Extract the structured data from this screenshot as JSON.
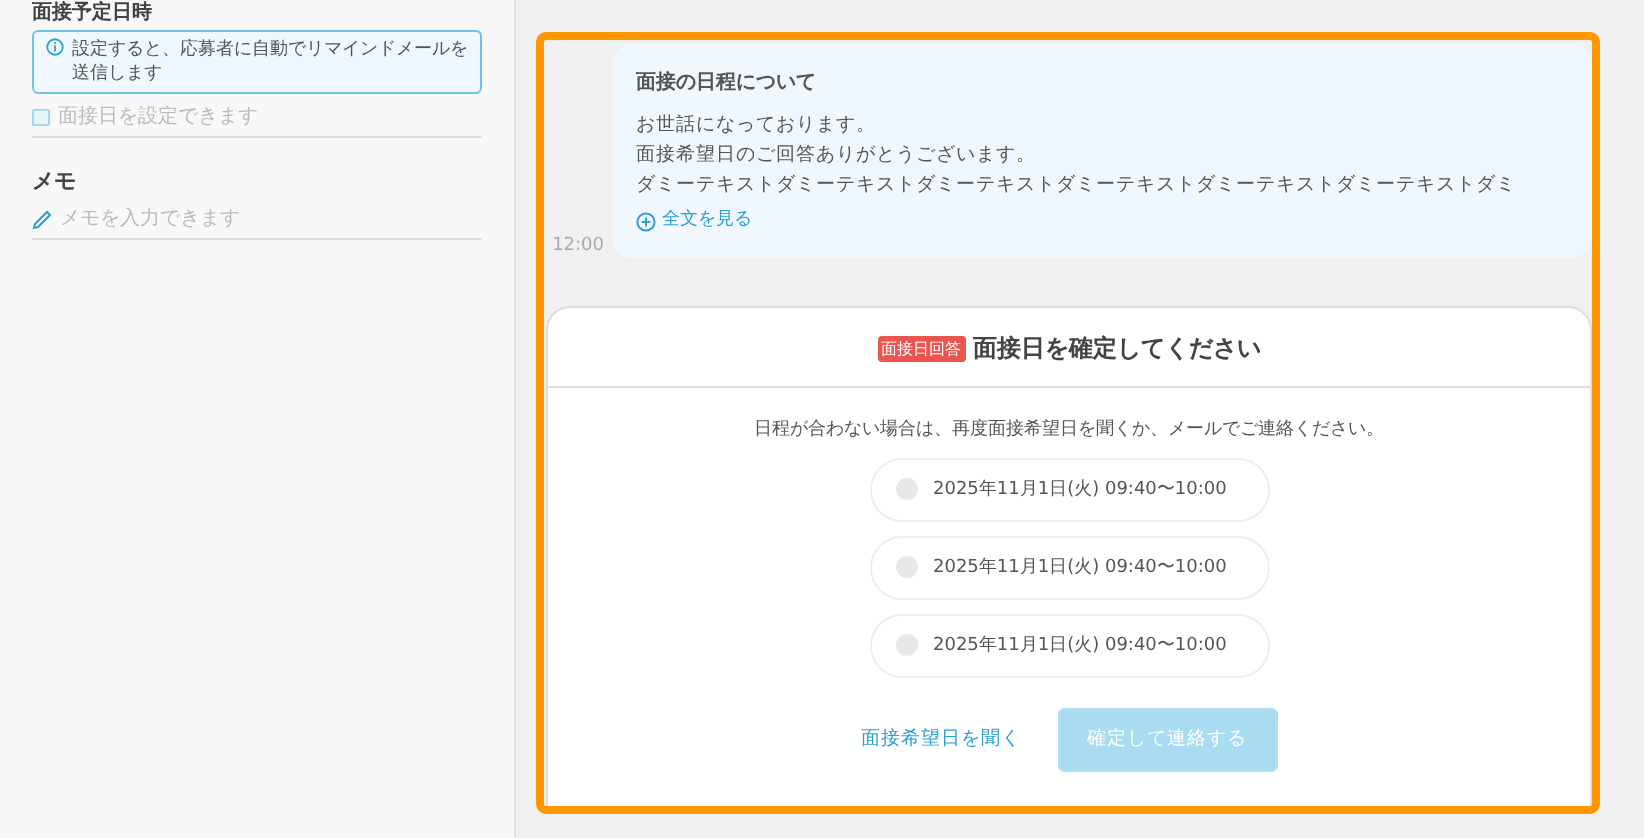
{
  "sidebar": {
    "schedule": {
      "label": "面接予定日時",
      "info": "設定すると、応募者に自動でリマインドメールを送信します",
      "placeholder": "面接日を設定できます"
    },
    "memo": {
      "label": "メモ",
      "placeholder": "メモを入力できます"
    }
  },
  "message": {
    "time": "12:00",
    "title": "面接の日程について",
    "lines": [
      "お世話になっております。",
      "面接希望日のご回答ありがとうございます。",
      "ダミーテキストダミーテキストダミーテキストダミーテキストダミーテキストダミーテキストダミ"
    ],
    "more": "全文を見る"
  },
  "dialog": {
    "badge": "面接日回答",
    "title": "面接日を確定してください",
    "note": "日程が合わない場合は、再度面接希望日を聞くか、メールでご連絡ください。",
    "options": [
      {
        "label": "2025年11月1日(火) 09:40〜10:00",
        "selected": false
      },
      {
        "label": "2025年11月1日(火) 09:40〜10:00",
        "selected": false
      },
      {
        "label": "2025年11月1日(火) 09:40〜10:00",
        "selected": false
      }
    ],
    "ask_link": "面接希望日を聞く",
    "confirm": {
      "label": "確定して連絡する",
      "disabled": true
    }
  }
}
